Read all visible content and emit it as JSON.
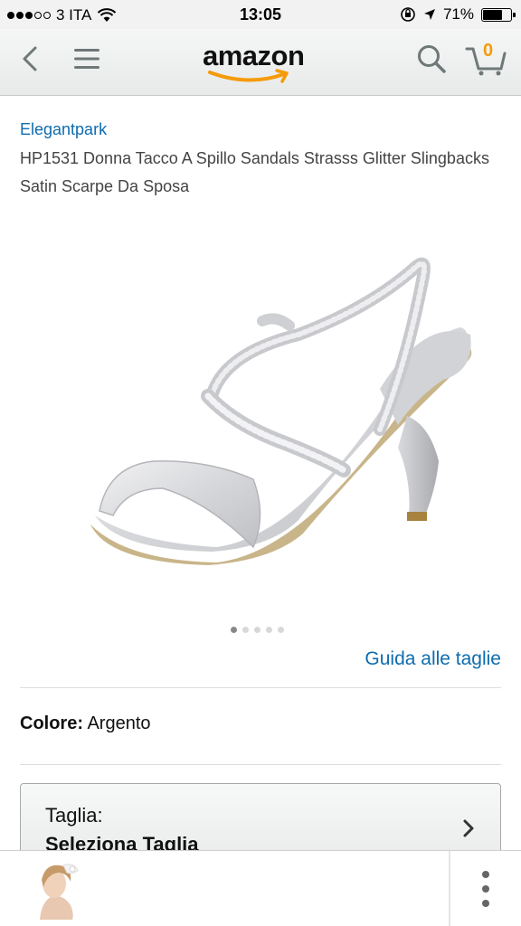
{
  "status_bar": {
    "carrier": "3 ITA",
    "time": "13:05",
    "battery": "71%",
    "battery_level": 0.71
  },
  "nav": {
    "logo": "amazon",
    "cart_count": "0",
    "icons": [
      "back-icon",
      "menu-icon",
      "search-icon",
      "cart-icon"
    ]
  },
  "product": {
    "brand": "Elegantpark",
    "title": "HP1531 Donna Tacco A Spillo Sandals Strasss Glitter Slingbacks Satin Scarpe Da Sposa",
    "image_count": 5,
    "active_image": 1,
    "size_guide_label": "Guida alle taglie",
    "color_label": "Colore:",
    "color_value": "Argento",
    "size_label": "Taglia:",
    "size_value": "Seleziona Taglia"
  },
  "bottom_bar": {
    "more_icon": "more-vertical-icon"
  },
  "colors": {
    "link": "#0e6cae",
    "smile": "#f59b0a"
  }
}
